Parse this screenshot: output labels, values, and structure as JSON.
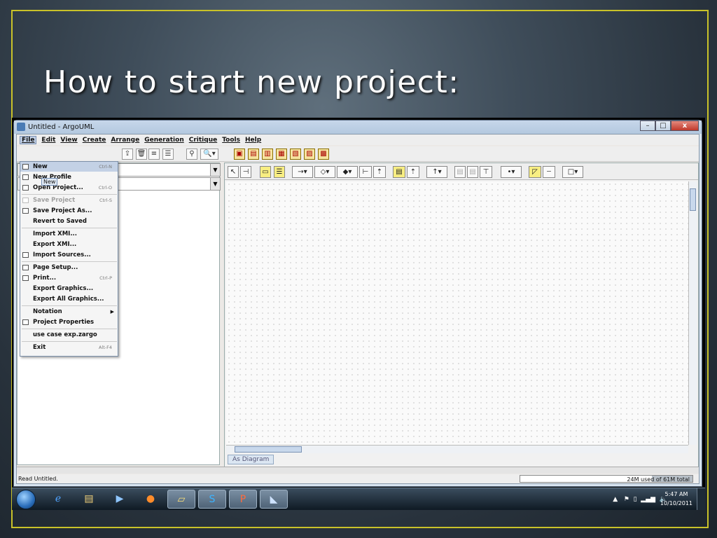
{
  "slide": {
    "title": "How to start new project:"
  },
  "window": {
    "title": "Untitled - ArgoUML",
    "buttons": {
      "minimize": "–",
      "maximize": "□",
      "close": "x"
    }
  },
  "menubar": [
    "File",
    "Edit",
    "View",
    "Create",
    "Arrange",
    "Generation",
    "Critique",
    "Tools",
    "Help"
  ],
  "file_menu": {
    "items": [
      {
        "label": "New",
        "accel": "Ctrl-N",
        "selected": true
      },
      {
        "label": "New Profile",
        "accel": ""
      },
      {
        "label": "Open Project...",
        "accel": "Ctrl-O"
      },
      {
        "label": "Save Project",
        "accel": "Ctrl-S",
        "disabled": true
      },
      {
        "label": "Save Project As...",
        "accel": ""
      },
      {
        "label": "Revert to Saved",
        "accel": ""
      },
      {
        "label": "Import XMI...",
        "accel": ""
      },
      {
        "label": "Export XMI...",
        "accel": ""
      },
      {
        "label": "Import Sources...",
        "accel": ""
      },
      {
        "label": "Page Setup...",
        "accel": ""
      },
      {
        "label": "Print...",
        "accel": "Ctrl-P"
      },
      {
        "label": "Export Graphics...",
        "accel": ""
      },
      {
        "label": "Export All Graphics...",
        "accel": ""
      },
      {
        "label": "Notation",
        "accel": ""
      },
      {
        "label": "Project Properties",
        "accel": ""
      },
      {
        "label": "use case exp.zargo",
        "accel": ""
      },
      {
        "label": "Exit",
        "accel": "Alt-F4"
      }
    ],
    "tooltip": "New"
  },
  "diagram": {
    "tab_label": "As Diagram"
  },
  "status": {
    "message": "Read Untitled.",
    "memory": "24M used of 61M total"
  },
  "taskbar": {
    "time": "5:47 AM",
    "date": "10/10/2011"
  },
  "colors": {
    "slide_border": "#c9c229",
    "menu_selected": "#c3d1e5",
    "taskbar": "#1b2834"
  }
}
